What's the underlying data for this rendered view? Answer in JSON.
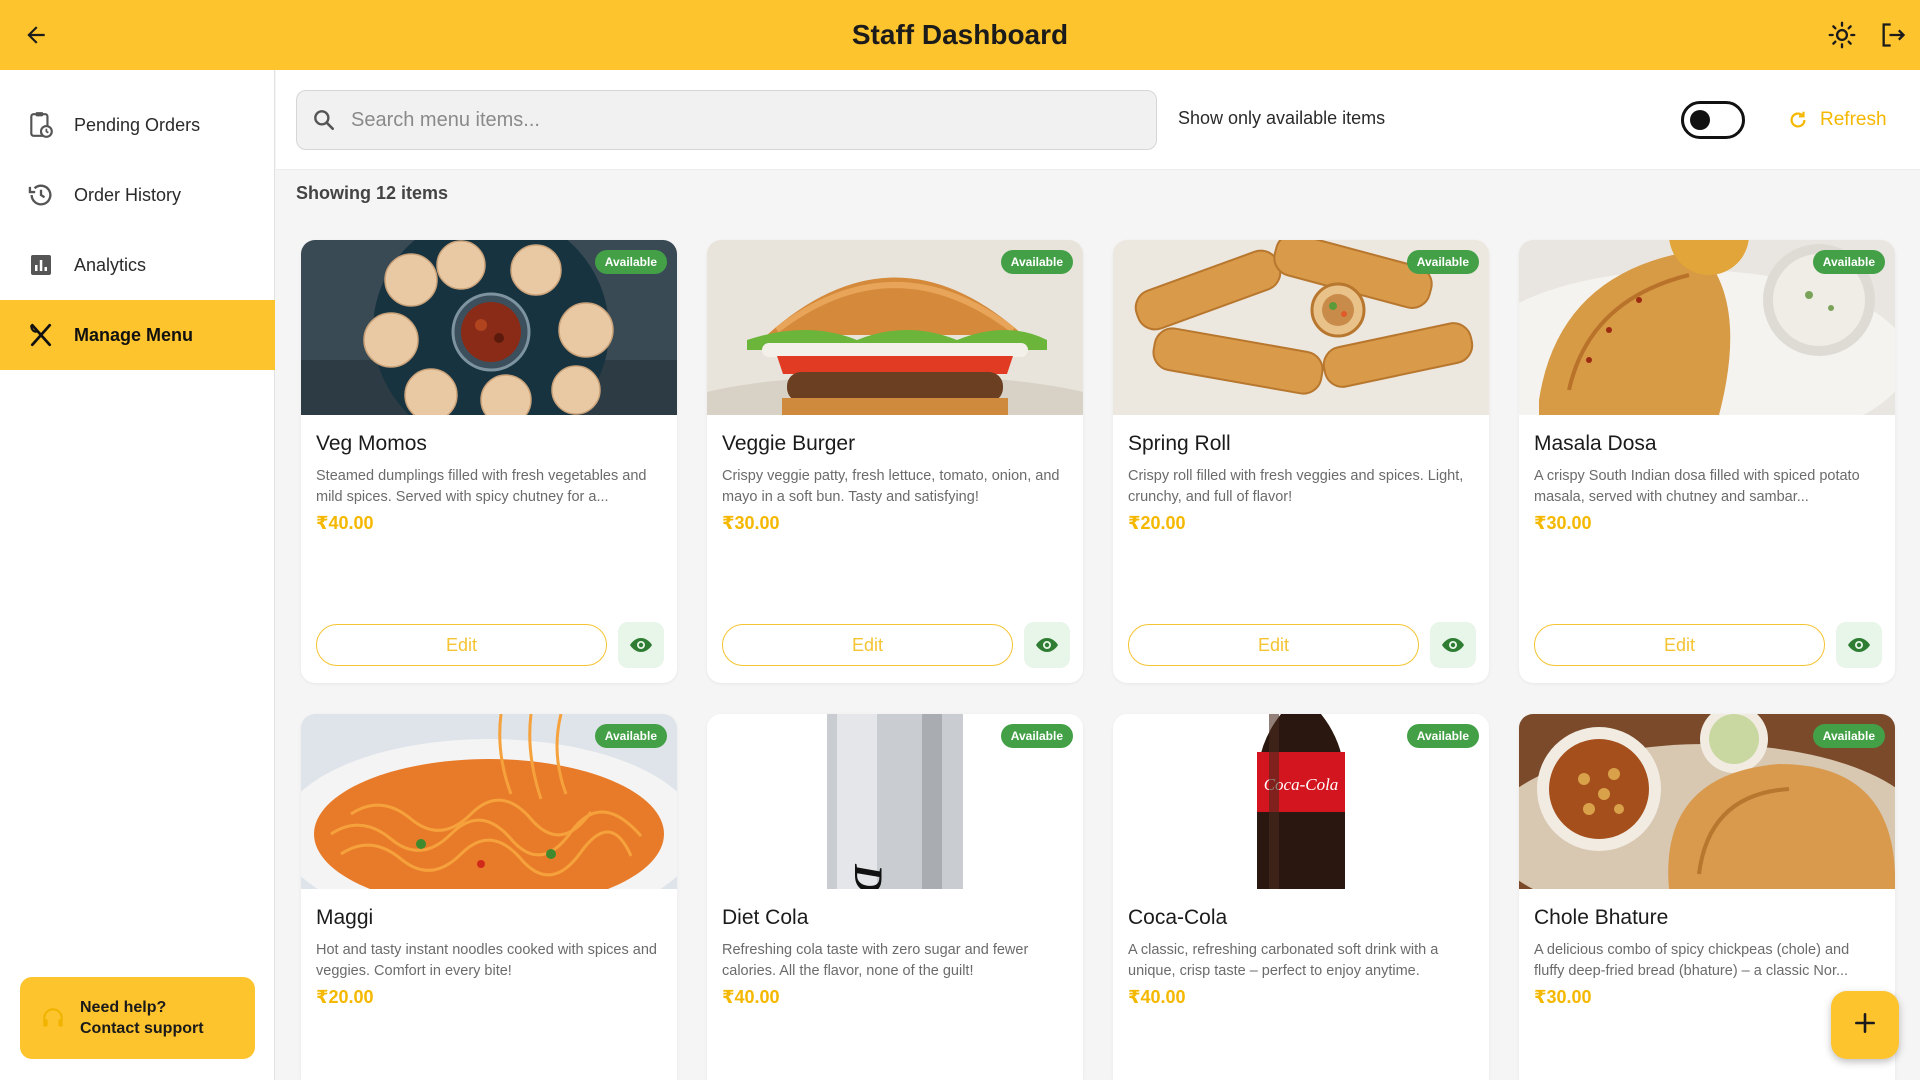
{
  "app": {
    "title": "Staff Dashboard"
  },
  "sidebar": {
    "items": [
      {
        "label": "Pending Orders",
        "icon": "clipboard-clock-icon"
      },
      {
        "label": "Order History",
        "icon": "history-icon"
      },
      {
        "label": "Analytics",
        "icon": "bar-chart-icon"
      },
      {
        "label": "Manage Menu",
        "icon": "fork-knife-icon",
        "active": true
      }
    ],
    "help_label": "Need help? Contact support"
  },
  "filters": {
    "search_placeholder": "Search menu items...",
    "search_value": "",
    "only_available_label": "Show only available items",
    "only_available_on": false,
    "refresh_label": "Refresh"
  },
  "count_label": "Showing 12 items",
  "cards": [
    {
      "name": "Veg Momos",
      "desc": "Steamed dumplings filled with fresh vegetables and mild spices. Served with spicy chutney for a...",
      "price": "₹40.00",
      "badge": "Available",
      "edit": "Edit"
    },
    {
      "name": "Veggie Burger",
      "desc": "Crispy veggie patty, fresh lettuce, tomato, onion, and mayo in a soft bun. Tasty and satisfying!",
      "price": "₹30.00",
      "badge": "Available",
      "edit": "Edit"
    },
    {
      "name": "Spring Roll",
      "desc": "Crispy roll filled with fresh veggies and spices. Light, crunchy, and full of flavor!",
      "price": "₹20.00",
      "badge": "Available",
      "edit": "Edit"
    },
    {
      "name": "Masala Dosa",
      "desc": "A crispy South Indian dosa filled with spiced potato masala, served with chutney and sambar...",
      "price": "₹30.00",
      "badge": "Available",
      "edit": "Edit"
    },
    {
      "name": "Maggi",
      "desc": "Hot and tasty instant noodles cooked with spices and veggies. Comfort in every bite!",
      "price": "₹20.00",
      "badge": "Available"
    },
    {
      "name": "Diet Cola",
      "desc": "Refreshing cola taste with zero sugar and fewer calories. All the flavor, none of the guilt!",
      "price": "₹40.00",
      "badge": "Available",
      "img_text": "Diet Coke"
    },
    {
      "name": "Coca-Cola",
      "desc": "A classic, refreshing carbonated soft drink with a unique, crisp taste – perfect to enjoy anytime.",
      "price": "₹40.00",
      "badge": "Available",
      "img_text": "Coca-Cola"
    },
    {
      "name": "Chole Bhature",
      "desc": "A delicious combo of spicy chickpeas (chole) and fluffy deep-fried bread (bhature) – a classic Nor...",
      "price": "₹30.00",
      "badge": "Available"
    }
  ],
  "colors": {
    "accent": "#fec42e",
    "price": "#f5b800",
    "available": "#43a047"
  },
  "icons": {
    "back": "arrow-left-icon",
    "theme": "sun-icon",
    "logout": "logout-icon",
    "search": "search-icon",
    "refresh": "refresh-icon",
    "eye": "eye-icon",
    "fab": "plus-icon"
  }
}
